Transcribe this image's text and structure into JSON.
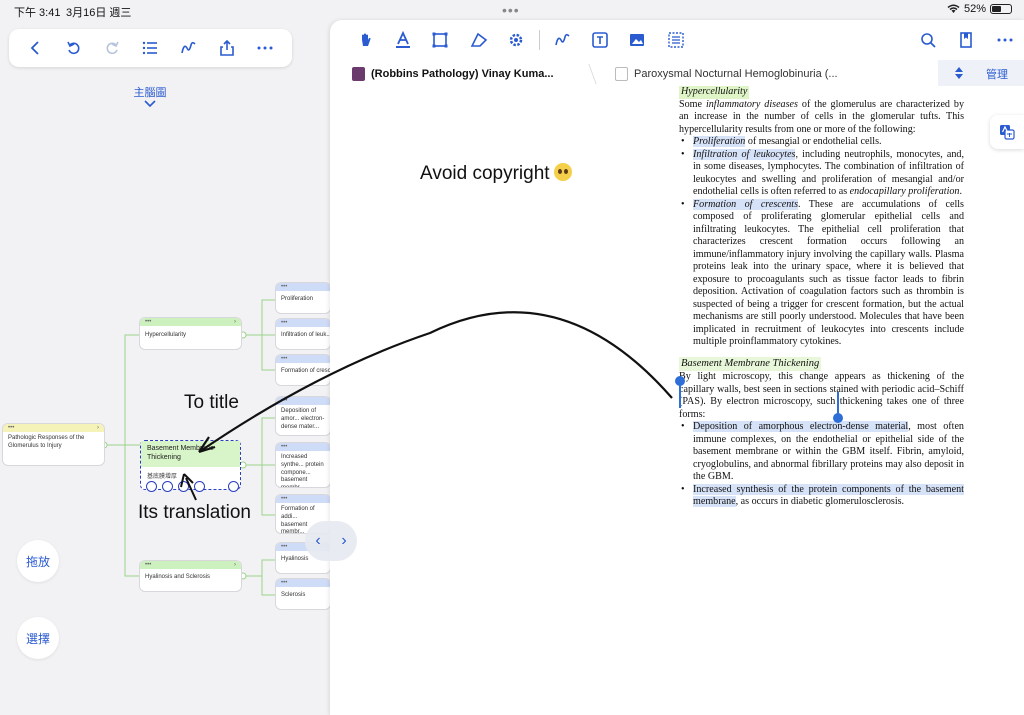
{
  "status": {
    "time": "下午 3:41",
    "date": "3月16日 週三",
    "battery": "52%",
    "battery_level": 0.52
  },
  "left_toolbar": {
    "icons": [
      "back-icon",
      "undo-icon",
      "redo-icon",
      "list-icon",
      "pen-icon",
      "share-icon",
      "more-icon"
    ]
  },
  "mindmap": {
    "title": "主腦圖",
    "root": "Pathologic Responses of the Glomerulus  to Injury",
    "nodes": {
      "hypercellularity": "Hypercellularity",
      "basement": "Basement Membrane Thickening",
      "basement_translation": "基底膜增厚",
      "hyalinosis": "Hyalinosis and Sclerosis",
      "proliferation": "Proliferation",
      "infiltration": "Infiltration of leuk...",
      "formation": "Formation of cresc...",
      "deposition": "Deposition of amor... electron-dense mater...",
      "increased": "Increased synthe... protein compone... basement membr...",
      "formation_add": "Formation of addi... basement membr...",
      "hyalinosis_child": "Hyalinosis",
      "sclerosis": "Sclerosis"
    },
    "drag_label": "拖放",
    "select_label": "選擇"
  },
  "annotations": {
    "to_title": "To title",
    "its_translation": "Its translation",
    "avoid_copyright": "Avoid copyright"
  },
  "pdf": {
    "manage_label": "管理",
    "tabs": [
      {
        "label": "(Robbins Pathology) Vinay Kuma...",
        "active": true
      },
      {
        "label": "Paroxysmal Nocturnal Hemoglobinuria (...",
        "active": false
      }
    ]
  },
  "doc": {
    "heading": "Hypercellularity",
    "intro_1": "Some ",
    "intro_em": "inflammatory diseases",
    "intro_2": " of the glomerulus are characterized by an increase in the number of cells in the glomerular tufts. This hypercellularity results from one or more of the following:",
    "b1_hl": "Proliferation",
    "b1_rest": " of mesangial or endothelial cells.",
    "b2_hl": "Infiltration of leukocytes",
    "b2_rest": ", including neutrophils, monocytes, and, in some diseases, lymphocytes. The combination of infiltration of leukocytes and swelling and proliferation of mesangial and/or endothelial cells is often referred to as ",
    "b2_em": "endocapillary proliferation",
    "b2_end": ".",
    "b3_hl": "Formation of crescents",
    "b3_rest": ". These are accumulations of cells composed of proliferating glomerular epithelial cells and infiltrating leukocytes. The epithelial cell proliferation that characterizes crescent formation occurs following an immune/inflammatory injury involving the capillary walls. Plasma proteins leak into the urinary space, where it is believed that exposure to procoagulants such as tissue factor leads to fibrin deposition. Activation of coagulation factors such as thrombin is suspected of being a trigger for crescent formation, but the actual mechanisms are still poorly understood. Molecules that have been implicated in recruitment of leukocytes into crescents include multiple proinflammatory cytokines.",
    "bmt_heading": "Basement Membrane Thickening",
    "bmt_intro": "By light microscopy, this change appears as thickening of the capillary walls, best seen in sections stained with periodic acid–Schiff (PAS). By electron microscopy, such thickening takes one of three forms:",
    "c1_hl": "Deposition of amorphous electron-dense material",
    "c1_rest": ", most often immune complexes, on the endothelial or epithelial side of the basement membrane or within the GBM itself. Fibrin, amyloid, cryoglobulins, and abnormal fibrillary proteins may also deposit in the GBM.",
    "c2_hl": "Increased synthesis of the protein components of the basement membrane",
    "c2_rest": ", as occurs in diabetic glomerulosclerosis."
  }
}
